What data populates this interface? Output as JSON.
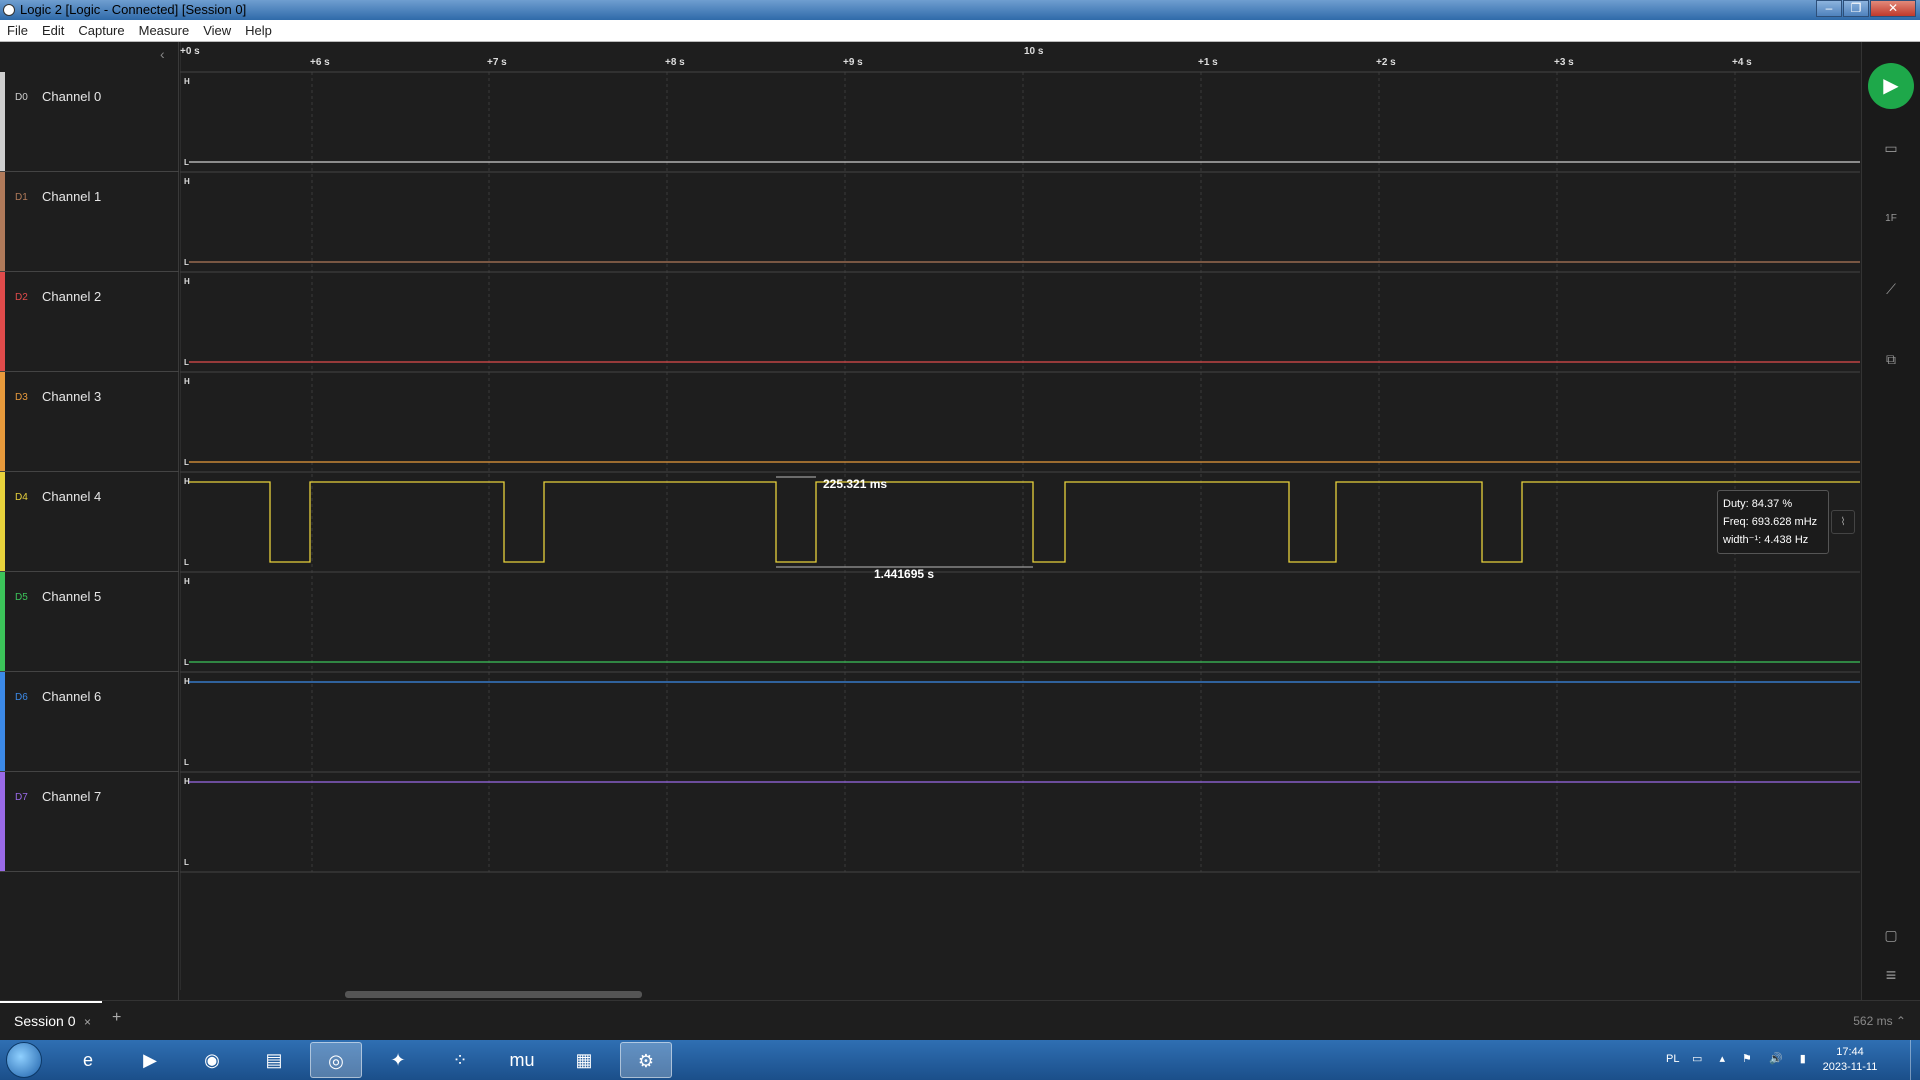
{
  "window": {
    "title": "Logic 2 [Logic - Connected] [Session 0]",
    "minimize": "–",
    "maximize": "❐",
    "close": "✕"
  },
  "menu": [
    "File",
    "Edit",
    "Capture",
    "Measure",
    "View",
    "Help"
  ],
  "channels": [
    {
      "id": "D0",
      "name": "Channel 0",
      "color": "#cfcfcf",
      "state": "low"
    },
    {
      "id": "D1",
      "name": "Channel 1",
      "color": "#b07a5a",
      "state": "low"
    },
    {
      "id": "D2",
      "name": "Channel 2",
      "color": "#e04b4b",
      "state": "low"
    },
    {
      "id": "D3",
      "name": "Channel 3",
      "color": "#e89a3c",
      "state": "low"
    },
    {
      "id": "D4",
      "name": "Channel 4",
      "color": "#e8d23c",
      "state": "pulse"
    },
    {
      "id": "D5",
      "name": "Channel 5",
      "color": "#3cc45a",
      "state": "low"
    },
    {
      "id": "D6",
      "name": "Channel 6",
      "color": "#3c8ae8",
      "state": "high"
    },
    {
      "id": "D7",
      "name": "Channel 7",
      "color": "#9a6ae8",
      "state": "high"
    }
  ],
  "level_labels": {
    "high": "H",
    "low": "L"
  },
  "timeline": {
    "start": "+0 s",
    "center": "10 s",
    "ticks": [
      "+6 s",
      "+7 s",
      "+8 s",
      "+9 s",
      "+1 s",
      "+2 s",
      "+3 s",
      "+4 s"
    ]
  },
  "measurements": {
    "pulse_width": "225.321 ms",
    "period": "1.441695 s"
  },
  "tooltip": {
    "duty": "Duty: 84.37 %",
    "freq": "Freq: 693.628 mHz",
    "width_inv": "width⁻¹: 4.438 Hz",
    "button_icon": "pulse-wave-icon"
  },
  "rightbar": {
    "run_icon": "play-icon",
    "icons": [
      "device-icon",
      "analyzer-icon",
      "measure-ruler-icon",
      "extensions-icon",
      "notes-icon",
      "menu-icon"
    ],
    "analyzer_label": "1F"
  },
  "tabs": [
    {
      "label": "Session 0",
      "close": "×"
    }
  ],
  "add_tab": "+",
  "zoom_level": "562 ms ⌃",
  "taskbar": {
    "apps": [
      "internet-explorer-icon",
      "media-player-icon",
      "web-globe-icon",
      "file-explorer-icon",
      "chrome-icon",
      "paint-icon",
      "dots-app-icon",
      "mu-editor-icon",
      "clapper-icon",
      "logic2-icon"
    ],
    "glyphs": [
      "e",
      "▶",
      "◉",
      "▤",
      "◎",
      "✦",
      "⁘",
      "mu",
      "▦",
      "⚙"
    ],
    "lang": "PL",
    "tray_glyphs": "▭ ▴ ⚑ 🔊 ▮",
    "time": "17:44",
    "date": "2023-11-11"
  }
}
